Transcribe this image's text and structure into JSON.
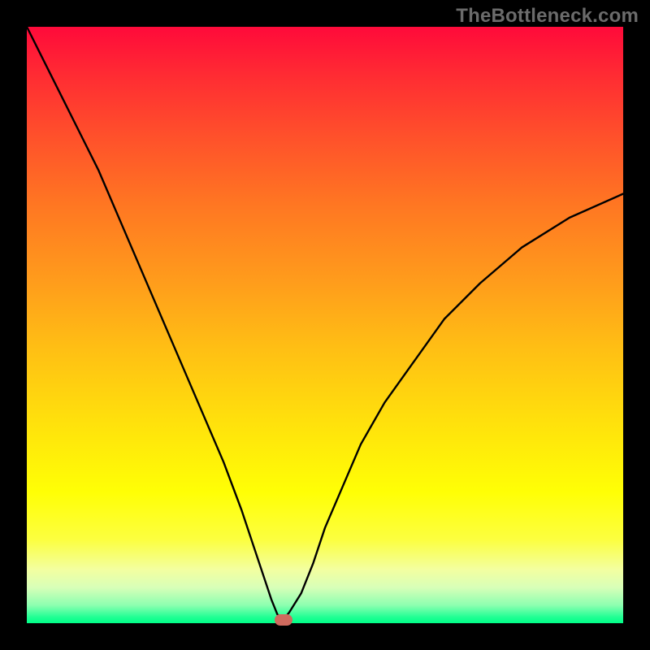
{
  "watermark": "TheBottleneck.com",
  "chart_data": {
    "type": "line",
    "title": "",
    "xlabel": "",
    "ylabel": "",
    "xlim": [
      0,
      100
    ],
    "ylim": [
      0,
      100
    ],
    "grid": false,
    "legend": false,
    "background_gradient": {
      "top_color": "#ff0a3a",
      "bottom_color": "#00ff88",
      "note": "Vertical gradient reads as bottleneck severity: red high, green low"
    },
    "series": [
      {
        "name": "bottleneck-curve",
        "color": "#000000",
        "x": [
          0,
          3,
          6,
          9,
          12,
          15,
          18,
          21,
          24,
          27,
          30,
          33,
          36,
          38,
          40,
          41,
          42,
          43,
          44,
          46,
          48,
          50,
          53,
          56,
          60,
          65,
          70,
          76,
          83,
          91,
          100
        ],
        "values": [
          100,
          94,
          88,
          82,
          76,
          69,
          62,
          55,
          48,
          41,
          34,
          27,
          19,
          13,
          7,
          4,
          1.5,
          0.6,
          1.8,
          5,
          10,
          16,
          23,
          30,
          37,
          44,
          51,
          57,
          63,
          68,
          72
        ]
      }
    ],
    "marker": {
      "x": 43,
      "y": 0.6,
      "label": "optimal-point",
      "color": "#cf6a5e"
    }
  }
}
